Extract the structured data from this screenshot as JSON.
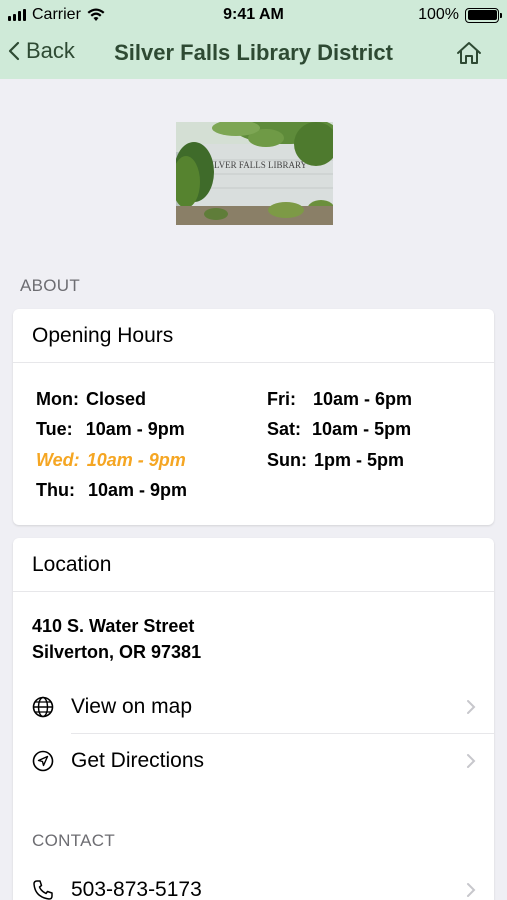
{
  "status_bar": {
    "carrier": "Carrier",
    "time": "9:41 AM",
    "battery": "100%"
  },
  "nav": {
    "back_label": "Back",
    "title": "Silver Falls Library District"
  },
  "photo": {
    "sign_text": "SILVER FALLS LIBRARY"
  },
  "about": {
    "section_label": "ABOUT"
  },
  "hours": {
    "title": "Opening Hours",
    "left": [
      {
        "day": "Mon:",
        "time": "Closed"
      },
      {
        "day": "Tue:",
        "time": "10am - 9pm"
      },
      {
        "day": "Wed:",
        "time": "10am - 9pm"
      },
      {
        "day": "Thu:",
        "time": "10am - 9pm"
      }
    ],
    "right": [
      {
        "day": "Fri:",
        "time": "10am - 6pm"
      },
      {
        "day": "Sat:",
        "time": "10am - 5pm"
      },
      {
        "day": "Sun:",
        "time": "1pm - 5pm"
      }
    ],
    "today_color": "#f5a623"
  },
  "location": {
    "title": "Location",
    "address_line1": "410 S. Water Street",
    "address_line2": "Silverton, OR 97381",
    "view_map_label": "View on map",
    "directions_label": "Get Directions"
  },
  "contact": {
    "section_label": "CONTACT",
    "phone": "503-873-5173"
  },
  "colors": {
    "nav_background": "#cfead8",
    "nav_text": "#2e4a33",
    "page_background": "#efeff4"
  }
}
